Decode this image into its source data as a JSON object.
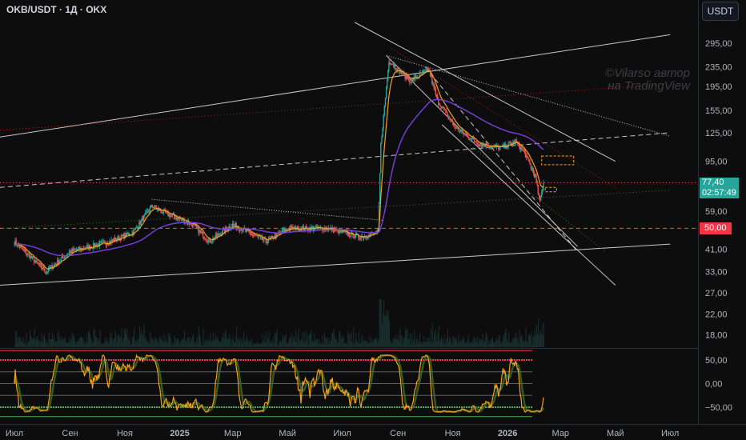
{
  "header": {
    "symbol": "OKB/USDT · 1Д · OKX",
    "currency_button": "USDT"
  },
  "watermark": {
    "line1": "©Vilarso автор",
    "line2": "на TradingView"
  },
  "price_axis": {
    "ticks": [
      "295,00",
      "235,00",
      "195,00",
      "155,00",
      "125,00",
      "95,00",
      "59,00",
      "41,00",
      "33,00",
      "27,00",
      "22,00",
      "18,00"
    ],
    "tick_values": [
      295,
      235,
      195,
      155,
      125,
      95,
      59,
      41,
      33,
      27,
      22,
      18
    ],
    "scale": "log"
  },
  "price_tags": {
    "current_price": "77,40",
    "countdown": "02:57:49",
    "level": "50,00",
    "current_color": "#26a69a",
    "level_color": "#f23645"
  },
  "oscillator_axis": {
    "ticks": [
      "50,00",
      "0,00",
      "−50,00"
    ],
    "tick_values": [
      50,
      0,
      -50
    ]
  },
  "time_axis": {
    "labels": [
      "Июл",
      "Сен",
      "Ноя",
      "2025",
      "Мар",
      "Май",
      "Июл",
      "Сен",
      "Ноя",
      "2026",
      "Мар",
      "Май",
      "Июл"
    ]
  },
  "colors": {
    "background": "#0d0d0d",
    "up_candle": "#26a69a",
    "down_candle": "#ef5350",
    "ema_fast": "#f7a21b",
    "ma_slow": "#7b3fe4",
    "osc_line": "#f7a21b",
    "osc_signal": "#3b6e2b",
    "osc_upper": "#f23645",
    "osc_lower": "#4caf50"
  },
  "chart_data": {
    "type": "candlestick",
    "title": "OKB/USDT · 1Д · OKX",
    "price_scale": "log",
    "ylim": [
      16,
      360
    ],
    "x_range": [
      "2024-06-15",
      "2026-08-01"
    ],
    "key_price_points": [
      {
        "date": "2024-07-01",
        "close": 44
      },
      {
        "date": "2024-08-05",
        "close": 33
      },
      {
        "date": "2024-09-01",
        "close": 40
      },
      {
        "date": "2024-10-15",
        "close": 44
      },
      {
        "date": "2024-11-10",
        "close": 48
      },
      {
        "date": "2024-12-01",
        "close": 62
      },
      {
        "date": "2024-12-15",
        "close": 58
      },
      {
        "date": "2025-01-15",
        "close": 52
      },
      {
        "date": "2025-02-03",
        "close": 44
      },
      {
        "date": "2025-03-01",
        "close": 52
      },
      {
        "date": "2025-04-07",
        "close": 44
      },
      {
        "date": "2025-05-01",
        "close": 50
      },
      {
        "date": "2025-06-15",
        "close": 50
      },
      {
        "date": "2025-07-20",
        "close": 46
      },
      {
        "date": "2025-08-10",
        "close": 48
      },
      {
        "date": "2025-08-13",
        "close": 112
      },
      {
        "date": "2025-08-22",
        "close": 250
      },
      {
        "date": "2025-09-15",
        "close": 205
      },
      {
        "date": "2025-10-05",
        "close": 230
      },
      {
        "date": "2025-10-15",
        "close": 170
      },
      {
        "date": "2025-11-05",
        "close": 130
      },
      {
        "date": "2025-12-01",
        "close": 112
      },
      {
        "date": "2025-12-25",
        "close": 108
      },
      {
        "date": "2026-01-10",
        "close": 115
      },
      {
        "date": "2026-01-20",
        "close": 103
      },
      {
        "date": "2026-02-01",
        "close": 82
      },
      {
        "date": "2026-02-06",
        "close": 64
      },
      {
        "date": "2026-02-10",
        "close": 77.4
      }
    ],
    "horizontal_levels": [
      77.4,
      50
    ],
    "oscillator": {
      "ylim": [
        -72,
        72
      ],
      "levels": [
        70,
        50,
        25,
        0,
        -25,
        -50,
        -70
      ]
    }
  }
}
